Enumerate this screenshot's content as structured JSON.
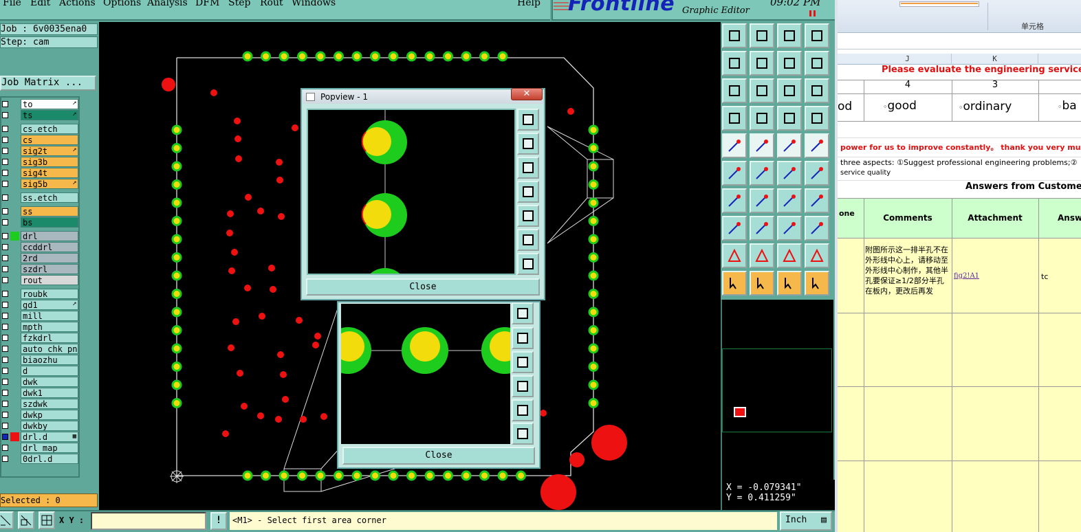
{
  "menu": [
    "File",
    "Edit",
    "Actions",
    "Options",
    "Analysis",
    "DFM",
    "Step",
    "Rout",
    "Windows",
    "Help"
  ],
  "brand": {
    "logo": "Frontline",
    "subtitle": "Graphic Editor",
    "clock": "09:02 PM"
  },
  "job": {
    "job_line": "Job : 6v0035ena0",
    "step_line": "Step: cam",
    "matrix_button": "Job Matrix ..."
  },
  "layers": [
    {
      "name": "to",
      "color": "#ffffff",
      "mark": "➚"
    },
    {
      "name": "ts",
      "color": "#1a8a6a",
      "mark": "➚"
    },
    {
      "name": "cs.etch",
      "color": "#a6ddd4",
      "mark": ""
    },
    {
      "name": "cs",
      "color": "#f6b84a",
      "mark": ""
    },
    {
      "name": "sig2t",
      "color": "#f6b84a",
      "mark": "➚"
    },
    {
      "name": "sig3b",
      "color": "#f6b84a",
      "mark": ""
    },
    {
      "name": "sig4t",
      "color": "#f6b84a",
      "mark": ""
    },
    {
      "name": "sig5b",
      "color": "#f6b84a",
      "mark": "➚"
    },
    {
      "name": "ss.etch",
      "color": "#a6ddd4",
      "mark": ""
    },
    {
      "name": "ss",
      "color": "#f6b84a",
      "mark": ""
    },
    {
      "name": "bs",
      "color": "#1a8a6a",
      "mark": ""
    },
    {
      "name": "drl",
      "color": "#a9b8bf",
      "mark": ""
    },
    {
      "name": "ccddrl",
      "color": "#a9b8bf",
      "mark": ""
    },
    {
      "name": "2rd",
      "color": "#a9b8bf",
      "mark": ""
    },
    {
      "name": "szdrl",
      "color": "#a9b8bf",
      "mark": ""
    },
    {
      "name": "rout",
      "color": "#d8d8d8",
      "mark": ""
    },
    {
      "name": "roubk",
      "color": "#a6ddd4",
      "mark": ""
    },
    {
      "name": "gd1",
      "color": "#a6ddd4",
      "mark": "➚"
    },
    {
      "name": "mill",
      "color": "#a6ddd4",
      "mark": ""
    },
    {
      "name": "mpth",
      "color": "#a6ddd4",
      "mark": ""
    },
    {
      "name": "fzkdrl",
      "color": "#a6ddd4",
      "mark": ""
    },
    {
      "name": "auto_chk_pnl",
      "color": "#a6ddd4",
      "mark": ""
    },
    {
      "name": "biaozhu",
      "color": "#a6ddd4",
      "mark": ""
    },
    {
      "name": "d",
      "color": "#a6ddd4",
      "mark": ""
    },
    {
      "name": "dwk",
      "color": "#a6ddd4",
      "mark": ""
    },
    {
      "name": "dwk1",
      "color": "#a6ddd4",
      "mark": ""
    },
    {
      "name": "szdwk",
      "color": "#a6ddd4",
      "mark": ""
    },
    {
      "name": "dwkp",
      "color": "#a6ddd4",
      "mark": ""
    },
    {
      "name": "dwkby",
      "color": "#a6ddd4",
      "mark": ""
    },
    {
      "name": "drl.d",
      "color": "#a6ddd4",
      "mark": "▦"
    },
    {
      "name": "drl_map",
      "color": "#a6ddd4",
      "mark": ""
    },
    {
      "name": "0drl.d",
      "color": "#a6ddd4",
      "mark": ""
    }
  ],
  "selected": "Selected : 0",
  "coords": {
    "x": "X = -0.079341\"",
    "y": "Y =  0.411259\""
  },
  "bottom": {
    "xy_label": "X Y :",
    "xy_value": "",
    "exclaim": "!",
    "prompt": "<M1> - Select first area corner",
    "unit": "Inch"
  },
  "popview": {
    "title": "Popview - 1",
    "close_x": "✕",
    "close_label": "Close"
  },
  "popview2": {
    "close_label": "Close"
  },
  "excel": {
    "ribbon_group": "单元格",
    "col_headers": [
      "J",
      "K"
    ],
    "title": "Please evaluate the engineering service",
    "scores": [
      "4",
      "3"
    ],
    "options": [
      "good",
      "ordinary",
      "ba"
    ],
    "option_partial": "od",
    "note1": "power for us to improve constantly。 thank you very much for",
    "note2": "three aspects: ①Suggest professional engineering problems;②",
    "note3": "service quality",
    "answers_title": "Answers from Customer",
    "headers": [
      "one",
      "Comments",
      "Attachment",
      "Answ"
    ],
    "comment": "附图所示这一排半孔不在外形线中心上，请移动至外形线中心制作，其他半孔要保证≥1/2部分半孔在板内，更改后再发",
    "attachment": "fig2!A1",
    "answer": "tc"
  },
  "colors": {
    "app_bg": "#5fa89a",
    "panel": "#a6ddd4",
    "accent_orange": "#f6b84a",
    "pad_green": "#1dcc1d",
    "pad_yellow": "#f3dc0c",
    "drill_red": "#ee1111",
    "excel_red": "#e01010",
    "excel_yellow": "#ffffc0",
    "excel_green": "#ccffcc"
  }
}
